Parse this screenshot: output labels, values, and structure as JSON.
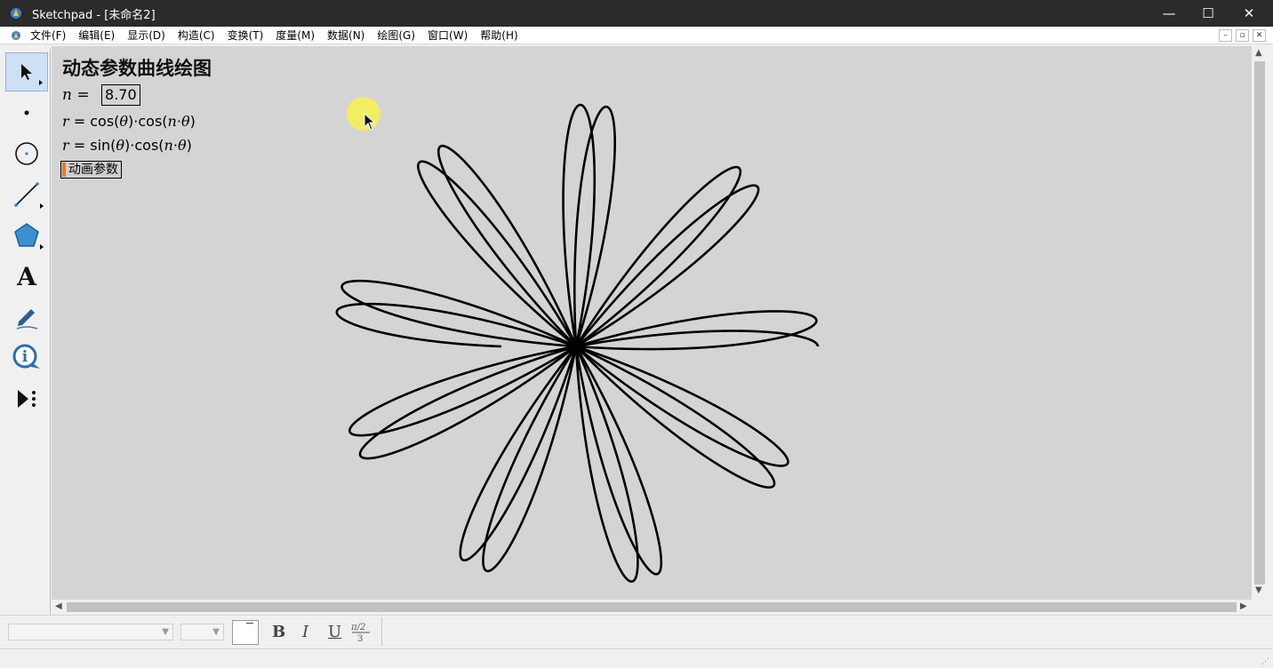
{
  "window": {
    "title": "Sketchpad  - [未命名2]",
    "controls": {
      "minimize": "—",
      "maximize": "☐",
      "close": "✕"
    }
  },
  "menu": {
    "items": [
      "文件(F)",
      "编辑(E)",
      "显示(D)",
      "构造(C)",
      "变换(T)",
      "度量(M)",
      "数据(N)",
      "绘图(G)",
      "窗口(W)",
      "帮助(H)"
    ],
    "mdi": {
      "minimize": "–",
      "restore": "▫",
      "close": "✕"
    }
  },
  "toolbox": {
    "tools": [
      {
        "name": "arrow-select-tool",
        "icon": "arrow-select-icon",
        "active": true
      },
      {
        "name": "point-tool",
        "icon": "point-icon"
      },
      {
        "name": "compass-tool",
        "icon": "circle-icon"
      },
      {
        "name": "straightedge-tool",
        "icon": "line-segment-icon"
      },
      {
        "name": "polygon-tool",
        "icon": "pentagon-icon"
      },
      {
        "name": "text-tool",
        "icon": "text-a-icon",
        "label": "A"
      },
      {
        "name": "marker-tool",
        "icon": "pen-icon"
      },
      {
        "name": "information-tool",
        "icon": "info-icon"
      },
      {
        "name": "custom-tools",
        "icon": "play-menu-icon"
      }
    ]
  },
  "sketch": {
    "title": "动态参数曲线绘图",
    "parameter": {
      "name": "n",
      "equals": " = ",
      "value": "8.70"
    },
    "formula1": {
      "lhs": "r",
      "a": " = cos(",
      "theta": "θ",
      "b": ")·cos(",
      "n": "n",
      "c": "·",
      "theta2": "θ",
      "d": ")"
    },
    "formula2": {
      "lhs": "r",
      "a": " = sin(",
      "theta": "θ",
      "b": ")·cos(",
      "n": "n",
      "c": "·",
      "theta2": "θ",
      "d": ")"
    },
    "animate_button": "动画参数",
    "curve_color": "#000000",
    "canvas_color": "#d4d4d4"
  },
  "text_toolbar": {
    "bold": "B",
    "italic": "I",
    "underline": "U",
    "math_format": "π/2 over 3"
  }
}
